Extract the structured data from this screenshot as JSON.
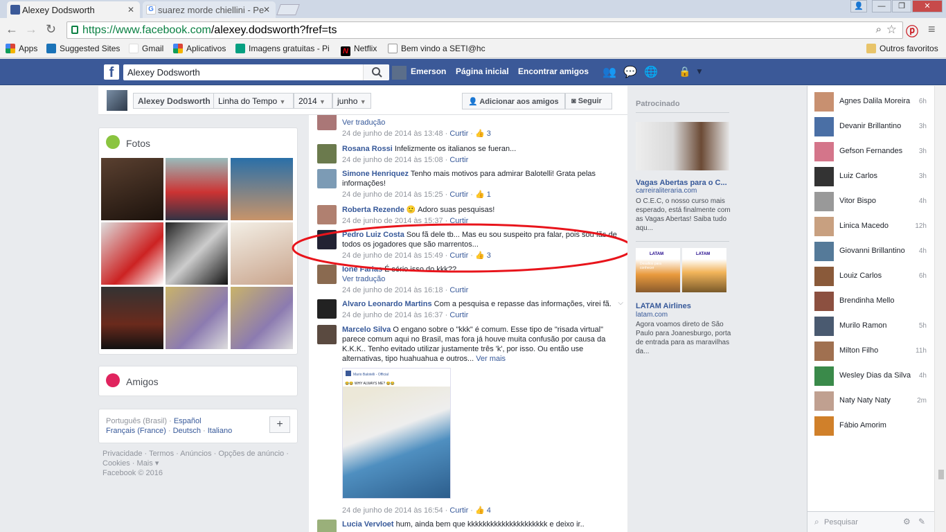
{
  "browser": {
    "tabs": [
      {
        "title": "Alexey Dodsworth",
        "favicon": "facebook-icon"
      },
      {
        "title": "suarez morde chiellini - Pe",
        "favicon": "google-icon"
      }
    ],
    "url_prefix": "https://www.facebook.com",
    "url_path": "/alexey.dodsworth?fref=ts",
    "bookmarks": [
      "Apps",
      "Suggested Sites",
      "Gmail",
      "Aplicativos",
      "Imagens gratuitas - Pi",
      "Netflix",
      "Bem vindo a SETI@hc"
    ],
    "other_bookmarks": "Outros favoritos"
  },
  "fb": {
    "search_value": "Alexey Dodsworth",
    "nav": {
      "user": "Emerson",
      "home": "Página inicial",
      "find_friends": "Encontrar amigos"
    },
    "profile_bar": {
      "name": "Alexey Dodsworth",
      "timeline": "Linha do Tempo",
      "year": "2014",
      "month": "junho",
      "add_friend": "Adicionar aos amigos",
      "follow": "Seguir"
    },
    "photos_title": "Fotos",
    "friends_title": "Amigos",
    "languages": {
      "line1_current": "Português (Brasil)",
      "line1_link": "Español",
      "line2": [
        "Français (France)",
        "Deutsch",
        "Italiano"
      ]
    },
    "footer": {
      "line1": [
        "Privacidade",
        "Termos",
        "Anúncios",
        "Opções de anúncio"
      ],
      "line2": [
        "Cookies",
        "Mais"
      ],
      "copyright": "Facebook © 2016"
    }
  },
  "comments": [
    {
      "name": "",
      "text": "",
      "translate": "Ver tradução",
      "time": "24 de junho de 2014 às 13:48",
      "like": "Curtir",
      "likes": "3"
    },
    {
      "name": "Rosana Rossi",
      "text": "Infelizmente os italianos se fueran...",
      "time": "24 de junho de 2014 às 15:08",
      "like": "Curtir",
      "likes": ""
    },
    {
      "name": "Simone Henriquez",
      "text": "Tenho mais motivos para admirar Balotelli! Grata pelas informações!",
      "time": "24 de junho de 2014 às 15:25",
      "like": "Curtir",
      "likes": "1"
    },
    {
      "name": "Roberta Rezende",
      "text": "🙂 Adoro suas pesquisas!",
      "time": "24 de junho de 2014 às 15:37",
      "like": "Curtir",
      "likes": ""
    },
    {
      "name": "Pedro Luiz Costa",
      "text": "Sou fã dele tb... Mas eu sou suspeito pra falar, pois sou fãs de todos os jogadores que são marrentos...",
      "time": "24 de junho de 2014 às 15:49",
      "like": "Curtir",
      "likes": "3"
    },
    {
      "name": "Ione Farias",
      "text": "É sério isso do kkk??",
      "translate": "Ver tradução",
      "time": "24 de junho de 2014 às 16:18",
      "like": "Curtir",
      "likes": ""
    },
    {
      "name": "Alvaro Leonardo Martins",
      "text": "Com a pesquisa e repasse das informações, virei fã.",
      "time": "24 de junho de 2014 às 16:37",
      "like": "Curtir",
      "likes": ""
    },
    {
      "name": "Marcelo Silva",
      "text": "O engano sobre o \"kkk\" é comum. Esse tipo de \"risada virtual\" parece comum aqui no Brasil, mas fora já houve muita confusão por causa da K.K.K.. Tenho evitado utilizar justamente três 'k', por isso. Ou então use alternativas, tipo huahuahua e outros...",
      "more": "Ver mais",
      "time": "24 de junho de 2014 às 16:54",
      "like": "Curtir",
      "likes": "4"
    },
    {
      "name": "Lucia Vervloet",
      "text": "hum, ainda bem que kkkkkkkkkkkkkkkkkkkkk e deixo ir..",
      "time": "",
      "like": "",
      "likes": ""
    }
  ],
  "embedded_post": {
    "page": "Mario Balotelli - Official",
    "text": "😂😂 WHY ALWAYS ME? 😂😂"
  },
  "sponsored": {
    "title": "Patrocinado",
    "ad1": {
      "headline": "Vagas Abertas para o C...",
      "domain": "carreiraliteraria.com",
      "body": "O C.E.C, o nosso curso mais esperado, está finalmente com as Vagas Abertas! Saiba tudo aqu..."
    },
    "ad2": {
      "headline": "LATAM Airlines",
      "domain": "latam.com",
      "body": "Agora voamos direto de São Paulo para Joanesburgo, porta de entrada para as maravilhas da...",
      "logo_text": "LATAM",
      "banner_text": "Desafios para\nconhecer"
    }
  },
  "chat": {
    "contacts": [
      {
        "name": "Agnes Dalila Moreira",
        "time": "6h"
      },
      {
        "name": "Devanir Brillantino",
        "time": "3h"
      },
      {
        "name": "Gefson Fernandes",
        "time": "3h"
      },
      {
        "name": "Luiz Carlos",
        "time": "3h"
      },
      {
        "name": "Vitor Bispo",
        "time": "4h"
      },
      {
        "name": "Linica Macedo",
        "time": "12h"
      },
      {
        "name": "Giovanni Brillantino",
        "time": "4h"
      },
      {
        "name": "Louiz Carlos",
        "time": "6h"
      },
      {
        "name": "Brendinha Mello",
        "time": ""
      },
      {
        "name": "Murilo Ramon",
        "time": "5h"
      },
      {
        "name": "Milton Filho",
        "time": "11h"
      },
      {
        "name": "Wesley Dias da Silva",
        "time": "4h"
      },
      {
        "name": "Naty Naty Naty",
        "time": "2m"
      },
      {
        "name": "Fábio Amorim",
        "time": ""
      }
    ],
    "search_placeholder": "Pesquisar"
  },
  "colors": {
    "fb_blue": "#3b5998",
    "link": "#365899",
    "annotation_red": "#e8141b"
  }
}
